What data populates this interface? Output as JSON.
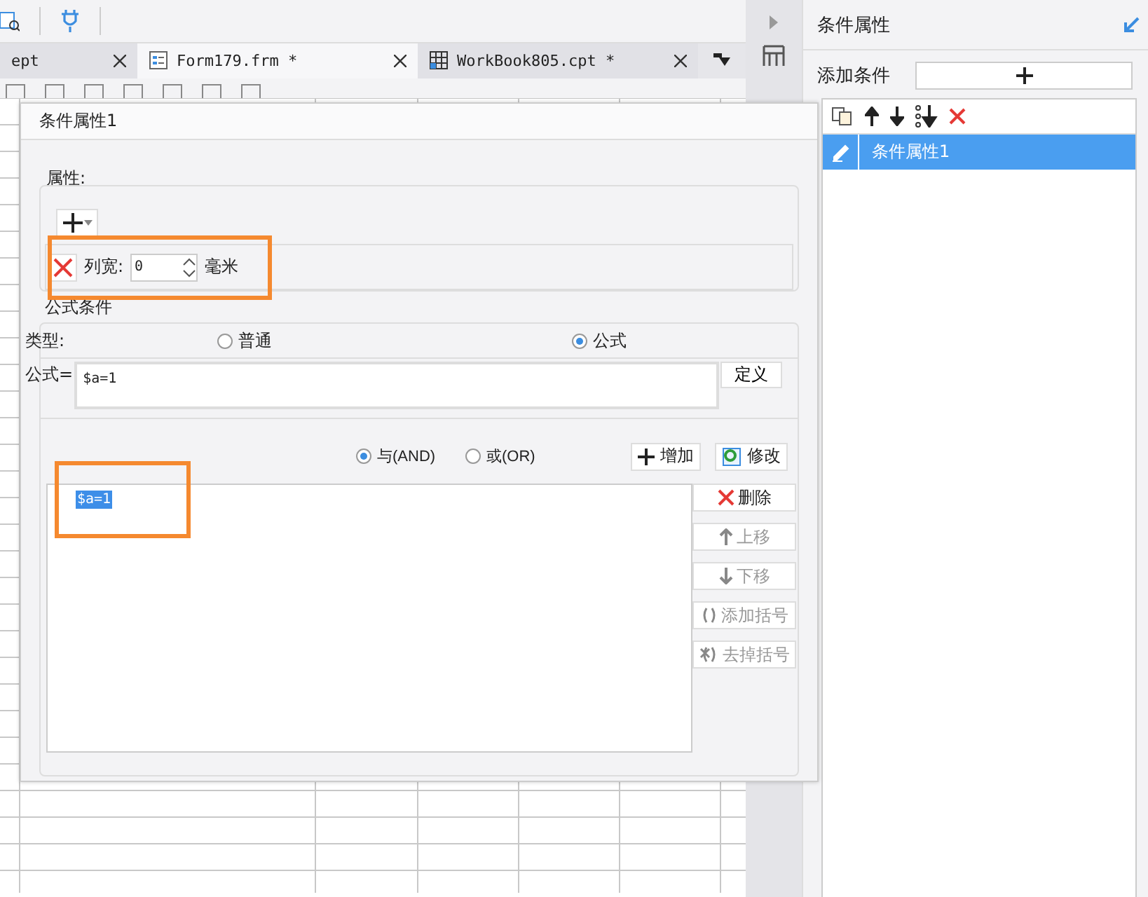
{
  "tabs": [
    {
      "label": "ept",
      "selected": false
    },
    {
      "label": "Form179.frm *",
      "selected": true
    },
    {
      "label": "WorkBook805.cpt *",
      "selected": false
    }
  ],
  "dialog": {
    "title": "条件属性1",
    "properties": {
      "label": "属性:",
      "attribute": {
        "label": "列宽:",
        "value": "0",
        "unit": "毫米"
      }
    },
    "formula_condition": {
      "label": "公式条件",
      "type_label": "类型:",
      "types": [
        {
          "label": "普通",
          "selected": false
        },
        {
          "label": "公式",
          "selected": true
        }
      ],
      "formula_label": "公式=",
      "formula": "$a=1",
      "define_button": "定义",
      "joins": [
        {
          "label": "与(AND)",
          "selected": true
        },
        {
          "label": "或(OR)",
          "selected": false
        }
      ],
      "add_button": "增加",
      "modify_button": "修改",
      "conditions": [
        {
          "text": "$a=1",
          "selected": true
        }
      ],
      "actions": [
        {
          "kind": "delete",
          "label": "删除",
          "disabled": false
        },
        {
          "kind": "up",
          "label": "上移",
          "disabled": true
        },
        {
          "kind": "down",
          "label": "下移",
          "disabled": true
        },
        {
          "kind": "add-bracket",
          "label": "添加括号",
          "disabled": true
        },
        {
          "kind": "remove-bracket",
          "label": "去掉括号",
          "disabled": true
        }
      ]
    }
  },
  "side_panel": {
    "title": "条件属性",
    "add_label": "添加条件",
    "items": [
      {
        "label": "条件属性1",
        "selected": true
      }
    ]
  }
}
